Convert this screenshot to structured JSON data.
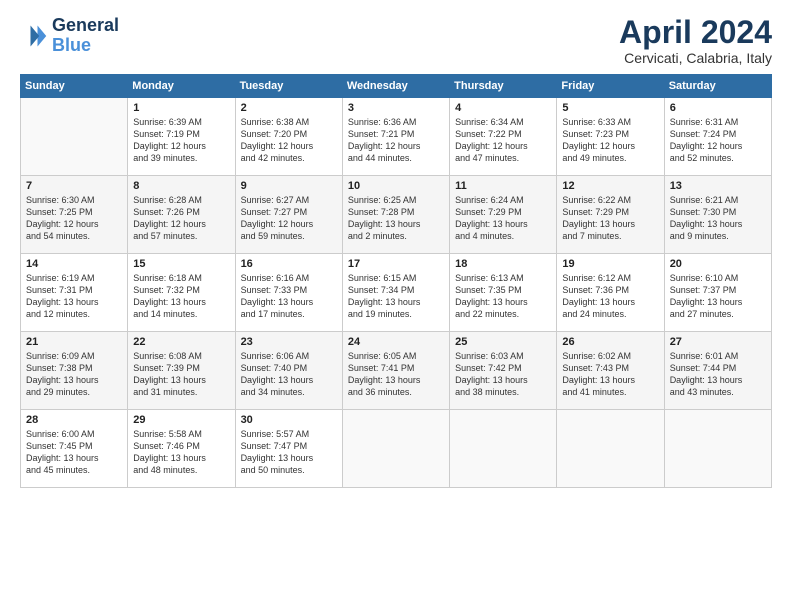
{
  "header": {
    "logo_line1": "General",
    "logo_line2": "Blue",
    "title": "April 2024",
    "location": "Cervicati, Calabria, Italy"
  },
  "columns": [
    "Sunday",
    "Monday",
    "Tuesday",
    "Wednesday",
    "Thursday",
    "Friday",
    "Saturday"
  ],
  "rows": [
    [
      {
        "day": "",
        "info": ""
      },
      {
        "day": "1",
        "info": "Sunrise: 6:39 AM\nSunset: 7:19 PM\nDaylight: 12 hours\nand 39 minutes."
      },
      {
        "day": "2",
        "info": "Sunrise: 6:38 AM\nSunset: 7:20 PM\nDaylight: 12 hours\nand 42 minutes."
      },
      {
        "day": "3",
        "info": "Sunrise: 6:36 AM\nSunset: 7:21 PM\nDaylight: 12 hours\nand 44 minutes."
      },
      {
        "day": "4",
        "info": "Sunrise: 6:34 AM\nSunset: 7:22 PM\nDaylight: 12 hours\nand 47 minutes."
      },
      {
        "day": "5",
        "info": "Sunrise: 6:33 AM\nSunset: 7:23 PM\nDaylight: 12 hours\nand 49 minutes."
      },
      {
        "day": "6",
        "info": "Sunrise: 6:31 AM\nSunset: 7:24 PM\nDaylight: 12 hours\nand 52 minutes."
      }
    ],
    [
      {
        "day": "7",
        "info": "Sunrise: 6:30 AM\nSunset: 7:25 PM\nDaylight: 12 hours\nand 54 minutes."
      },
      {
        "day": "8",
        "info": "Sunrise: 6:28 AM\nSunset: 7:26 PM\nDaylight: 12 hours\nand 57 minutes."
      },
      {
        "day": "9",
        "info": "Sunrise: 6:27 AM\nSunset: 7:27 PM\nDaylight: 12 hours\nand 59 minutes."
      },
      {
        "day": "10",
        "info": "Sunrise: 6:25 AM\nSunset: 7:28 PM\nDaylight: 13 hours\nand 2 minutes."
      },
      {
        "day": "11",
        "info": "Sunrise: 6:24 AM\nSunset: 7:29 PM\nDaylight: 13 hours\nand 4 minutes."
      },
      {
        "day": "12",
        "info": "Sunrise: 6:22 AM\nSunset: 7:29 PM\nDaylight: 13 hours\nand 7 minutes."
      },
      {
        "day": "13",
        "info": "Sunrise: 6:21 AM\nSunset: 7:30 PM\nDaylight: 13 hours\nand 9 minutes."
      }
    ],
    [
      {
        "day": "14",
        "info": "Sunrise: 6:19 AM\nSunset: 7:31 PM\nDaylight: 13 hours\nand 12 minutes."
      },
      {
        "day": "15",
        "info": "Sunrise: 6:18 AM\nSunset: 7:32 PM\nDaylight: 13 hours\nand 14 minutes."
      },
      {
        "day": "16",
        "info": "Sunrise: 6:16 AM\nSunset: 7:33 PM\nDaylight: 13 hours\nand 17 minutes."
      },
      {
        "day": "17",
        "info": "Sunrise: 6:15 AM\nSunset: 7:34 PM\nDaylight: 13 hours\nand 19 minutes."
      },
      {
        "day": "18",
        "info": "Sunrise: 6:13 AM\nSunset: 7:35 PM\nDaylight: 13 hours\nand 22 minutes."
      },
      {
        "day": "19",
        "info": "Sunrise: 6:12 AM\nSunset: 7:36 PM\nDaylight: 13 hours\nand 24 minutes."
      },
      {
        "day": "20",
        "info": "Sunrise: 6:10 AM\nSunset: 7:37 PM\nDaylight: 13 hours\nand 27 minutes."
      }
    ],
    [
      {
        "day": "21",
        "info": "Sunrise: 6:09 AM\nSunset: 7:38 PM\nDaylight: 13 hours\nand 29 minutes."
      },
      {
        "day": "22",
        "info": "Sunrise: 6:08 AM\nSunset: 7:39 PM\nDaylight: 13 hours\nand 31 minutes."
      },
      {
        "day": "23",
        "info": "Sunrise: 6:06 AM\nSunset: 7:40 PM\nDaylight: 13 hours\nand 34 minutes."
      },
      {
        "day": "24",
        "info": "Sunrise: 6:05 AM\nSunset: 7:41 PM\nDaylight: 13 hours\nand 36 minutes."
      },
      {
        "day": "25",
        "info": "Sunrise: 6:03 AM\nSunset: 7:42 PM\nDaylight: 13 hours\nand 38 minutes."
      },
      {
        "day": "26",
        "info": "Sunrise: 6:02 AM\nSunset: 7:43 PM\nDaylight: 13 hours\nand 41 minutes."
      },
      {
        "day": "27",
        "info": "Sunrise: 6:01 AM\nSunset: 7:44 PM\nDaylight: 13 hours\nand 43 minutes."
      }
    ],
    [
      {
        "day": "28",
        "info": "Sunrise: 6:00 AM\nSunset: 7:45 PM\nDaylight: 13 hours\nand 45 minutes."
      },
      {
        "day": "29",
        "info": "Sunrise: 5:58 AM\nSunset: 7:46 PM\nDaylight: 13 hours\nand 48 minutes."
      },
      {
        "day": "30",
        "info": "Sunrise: 5:57 AM\nSunset: 7:47 PM\nDaylight: 13 hours\nand 50 minutes."
      },
      {
        "day": "",
        "info": ""
      },
      {
        "day": "",
        "info": ""
      },
      {
        "day": "",
        "info": ""
      },
      {
        "day": "",
        "info": ""
      }
    ]
  ]
}
